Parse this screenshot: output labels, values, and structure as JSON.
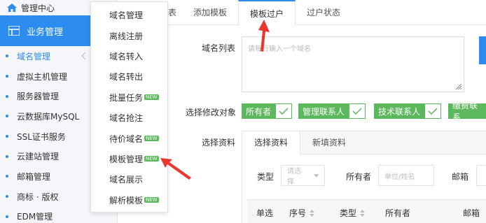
{
  "sidebar": {
    "top_label": "管理中心",
    "section_label": "业务管理",
    "items": [
      {
        "label": "域名管理"
      },
      {
        "label": "虚拟主机管理"
      },
      {
        "label": "服务器管理"
      },
      {
        "label": "云数据库MySQL"
      },
      {
        "label": "SSL证书服务"
      },
      {
        "label": "云建站管理"
      },
      {
        "label": "邮箱管理"
      },
      {
        "label": "商标 · 版权"
      },
      {
        "label": "EDM管理"
      }
    ]
  },
  "tabs": {
    "t0": "表",
    "t1": "添加模板",
    "t2": "模板过户",
    "t3": "过户状态"
  },
  "form": {
    "domain_list_label": "域名列表",
    "textarea_placeholder": "请每行输入一个域名",
    "modify_target_label": "选择修改对象",
    "chips": [
      "所有者",
      "管理联系人",
      "技术联系人",
      "缴费联系"
    ],
    "select_info_label": "选择资料"
  },
  "panel": {
    "tab_active": "选择资料",
    "tab_other": "新填资料",
    "type_label": "类型",
    "type_placeholder": "请选择",
    "owner_label": "所有者",
    "owner_placeholder": "单位/姓名",
    "email_label": "邮箱",
    "columns": [
      "单选",
      "序号",
      "类型",
      "所有者",
      "邮箱"
    ]
  },
  "menu": {
    "items": [
      {
        "label": "域名管理",
        "badge": ""
      },
      {
        "label": "离线注册",
        "badge": ""
      },
      {
        "label": "域名转入",
        "badge": ""
      },
      {
        "label": "域名转出",
        "badge": ""
      },
      {
        "label": "批量任务",
        "badge": "NEW"
      },
      {
        "label": "域名抢注",
        "badge": ""
      },
      {
        "label": "待价域名",
        "badge": "NEW"
      },
      {
        "label": "模板管理",
        "badge": "NEW"
      },
      {
        "label": "域名展示",
        "badge": ""
      },
      {
        "label": "解析模板",
        "badge": "NEW"
      }
    ]
  },
  "colors": {
    "accent": "#2d8cf0",
    "chip_green": "#5cb85c",
    "annotation_red": "#e8372f"
  }
}
